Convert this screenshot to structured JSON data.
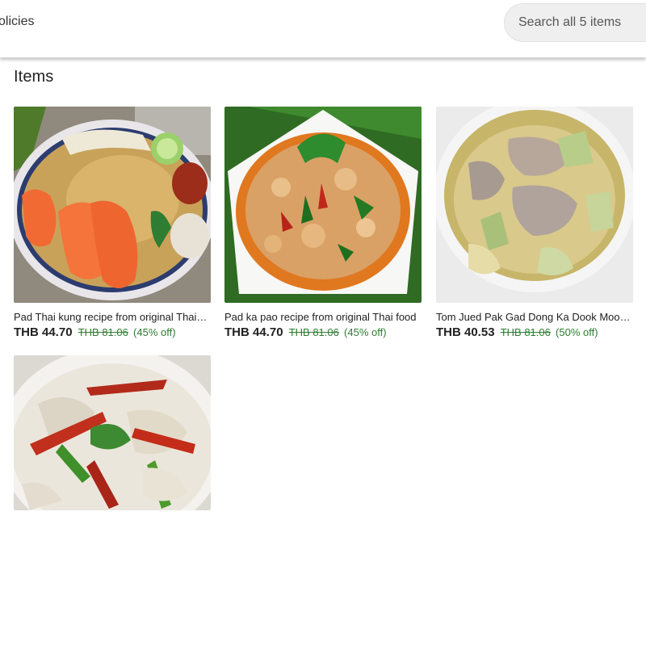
{
  "header": {
    "nav_label": "olicies",
    "search_placeholder": "Search all 5 items"
  },
  "section": {
    "title": "Items"
  },
  "items": [
    {
      "title": "Pad Thai kung recipe from original Thai food - Pad Thai with Shrimp",
      "price": "THB 44.70",
      "original_price": "THB 81.06",
      "discount": "(45% off)",
      "image_icon": "pad-thai-image"
    },
    {
      "title": "Pad ka pao recipe from original Thai food",
      "price": "THB 44.70",
      "original_price": "THB 81.06",
      "discount": "(45% off)",
      "image_icon": "pad-ka-pao-image"
    },
    {
      "title": "Tom Jued Pak Gad Dong Ka Dook Moo recipe",
      "price": "THB 40.53",
      "original_price": "THB 81.06",
      "discount": "(50% off)",
      "image_icon": "tom-jued-image"
    },
    {
      "title": "",
      "price": "",
      "original_price": "",
      "discount": "",
      "image_icon": "tom-kha-image"
    }
  ]
}
